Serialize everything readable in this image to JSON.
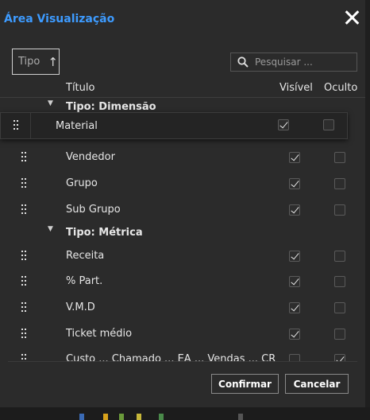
{
  "dialog": {
    "title": "Área Visualização",
    "close_icon": "close-icon"
  },
  "sort": {
    "label": "Tipo",
    "direction": "ascending",
    "icon": "arrow-up-icon"
  },
  "search": {
    "placeholder": "Pesquisar ...",
    "value": "",
    "icon": "search-icon"
  },
  "columns": {
    "title": "Título",
    "visible": "Visível",
    "hidden": "Oculto"
  },
  "groups": [
    {
      "label": "Tipo: Dimensão",
      "items": [
        {
          "label": "Material",
          "visible": true,
          "hidden": false,
          "dragging": true
        },
        {
          "label": "Vendedor",
          "visible": true,
          "hidden": false
        },
        {
          "label": "Grupo",
          "visible": true,
          "hidden": false
        },
        {
          "label": "Sub Grupo",
          "visible": true,
          "hidden": false
        }
      ]
    },
    {
      "label": "Tipo: Métrica",
      "items": [
        {
          "label": "Receita",
          "visible": true,
          "hidden": false
        },
        {
          "label": "% Part.",
          "visible": true,
          "hidden": false
        },
        {
          "label": "V.M.D",
          "visible": true,
          "hidden": false
        },
        {
          "label": "Ticket médio",
          "visible": true,
          "hidden": false
        },
        {
          "label": "Custo ... Chamado ... EA ... Vendas ... CR",
          "visible": false,
          "hidden": true
        }
      ]
    }
  ],
  "buttons": {
    "confirm": "Confirmar",
    "cancel": "Cancelar"
  },
  "colors": {
    "accent": "#3d9bff",
    "background": "#2b2b2b"
  }
}
